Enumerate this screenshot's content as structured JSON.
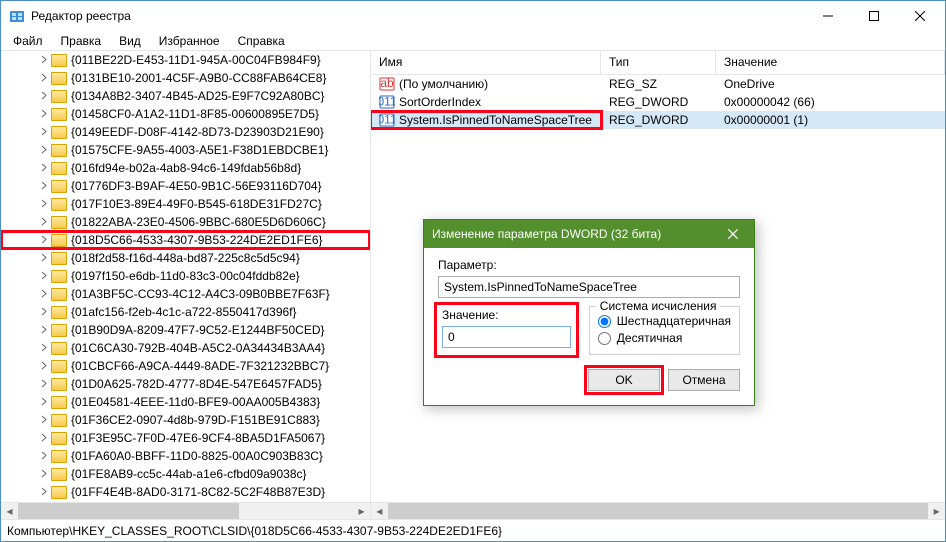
{
  "window": {
    "title": "Редактор реестра"
  },
  "menu": {
    "file": "Файл",
    "edit": "Правка",
    "view": "Вид",
    "fav": "Избранное",
    "help": "Справка"
  },
  "tree": {
    "items": [
      "{011BE22D-E453-11D1-945A-00C04FB984F9}",
      "{0131BE10-2001-4C5F-A9B0-CC88FAB64CE8}",
      "{0134A8B2-3407-4B45-AD25-E9F7C92A80BC}",
      "{01458CF0-A1A2-11D1-8F85-00600895E7D5}",
      "{0149EEDF-D08F-4142-8D73-D23903D21E90}",
      "{01575CFE-9A55-4003-A5E1-F38D1EBDCBE1}",
      "{016fd94e-b02a-4ab8-94c6-149fdab56b8d}",
      "{01776DF3-B9AF-4E50-9B1C-56E93116D704}",
      "{017F10E3-89E4-49F0-B545-618DE31FD27C}",
      "{01822ABA-23E0-4506-9BBC-680E5D6D606C}",
      "{018D5C66-4533-4307-9B53-224DE2ED1FE6}",
      "{018f2d58-f16d-448a-bd87-225c8c5d5c94}",
      "{0197f150-e6db-11d0-83c3-00c04fddb82e}",
      "{01A3BF5C-CC93-4C12-A4C3-09B0BBE7F63F}",
      "{01afc156-f2eb-4c1c-a722-8550417d396f}",
      "{01B90D9A-8209-47F7-9C52-E1244BF50CED}",
      "{01C6CA30-792B-404B-A5C2-0A34434B3AA4}",
      "{01CBCF66-A9CA-4449-8ADE-7F321232BBC7}",
      "{01D0A625-782D-4777-8D4E-547E6457FAD5}",
      "{01E04581-4EEE-11d0-BFE9-00AA005B4383}",
      "{01F36CE2-0907-4d8b-979D-F151BE91C883}",
      "{01F3E95C-7F0D-47E6-9CF4-8BA5D1FA5067}",
      "{01FA60A0-BBFF-11D0-8825-00A0C903B83C}",
      "{01FE8AB9-cc5c-44ab-a1e6-cfbd09a9038c}",
      "{01FF4E4B-8AD0-3171-8C82-5C2F48B87E3D}"
    ],
    "selected_index": 10
  },
  "list": {
    "headers": {
      "name": "Имя",
      "type": "Тип",
      "value": "Значение"
    },
    "rows": [
      {
        "icon": "string",
        "name": "(По умолчанию)",
        "type": "REG_SZ",
        "value": "OneDrive"
      },
      {
        "icon": "binary",
        "name": "SortOrderIndex",
        "type": "REG_DWORD",
        "value": "0x00000042 (66)"
      },
      {
        "icon": "binary",
        "name": "System.IsPinnedToNameSpaceTree",
        "type": "REG_DWORD",
        "value": "0x00000001 (1)"
      }
    ],
    "selected_index": 2
  },
  "dialog": {
    "title": "Изменение параметра DWORD (32 бита)",
    "param_label": "Параметр:",
    "param_value": "System.IsPinnedToNameSpaceTree",
    "value_label": "Значение:",
    "value_input": "0",
    "radix_label": "Система исчисления",
    "radix_hex": "Шестнадцатеричная",
    "radix_dec": "Десятичная",
    "ok": "OK",
    "cancel": "Отмена"
  },
  "status": {
    "path": "Компьютер\\HKEY_CLASSES_ROOT\\CLSID\\{018D5C66-4533-4307-9B53-224DE2ED1FE6}"
  }
}
